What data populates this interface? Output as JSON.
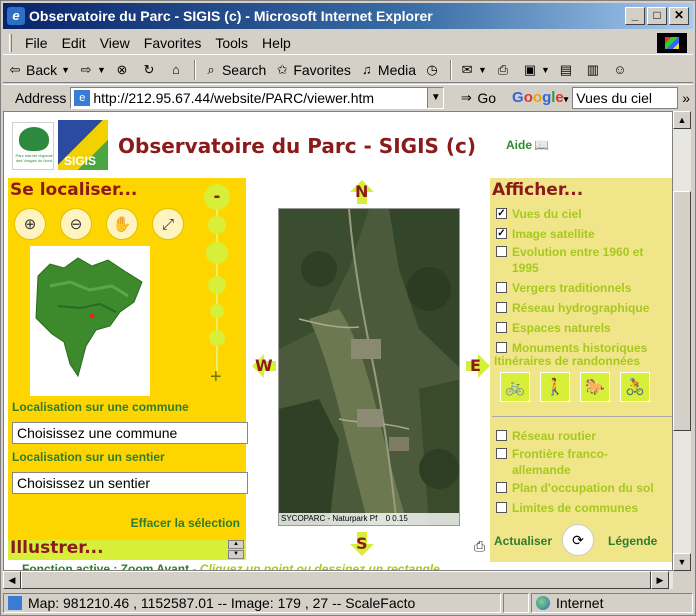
{
  "window": {
    "title": "Observatoire du Parc - SIGIS (c) - Microsoft Internet Explorer",
    "controls": {
      "minimize": "_",
      "maximize": "□",
      "close": "✕"
    }
  },
  "menu": [
    "File",
    "Edit",
    "View",
    "Favorites",
    "Tools",
    "Help"
  ],
  "toolbar": {
    "back": "Back",
    "search": "Search",
    "favorites": "Favorites",
    "media": "Media"
  },
  "address": {
    "label": "Address",
    "url": "http://212.95.67.44/website/PARC/viewer.htm",
    "go": "Go",
    "google_search_value": "Vues du ciel",
    "google_letters": [
      "G",
      "o",
      "o",
      "g",
      "l",
      "e"
    ]
  },
  "status": {
    "text": "Map: 981210.46 , 1152587.01 -- Image: 179 , 27 -- ScaleFacto",
    "zone": "Internet"
  },
  "page": {
    "title": "Observatoire du Parc - SIGIS (c)",
    "help": "Aide",
    "logo2_text": "SIGIS",
    "logo1_text": "Parc naturel régional des Vosges du Nord"
  },
  "left": {
    "title": "Se localiser...",
    "zoom_minus": "-",
    "zoom_plus": "+",
    "commune_label": "Localisation sur une commune",
    "commune_value": "Choisissez une commune",
    "sentier_label": "Localisation sur un sentier",
    "sentier_value": "Choisissez un sentier",
    "clear": "Effacer la sélection",
    "illustrer": "Illustrer..."
  },
  "compass": {
    "n": "N",
    "s": "S",
    "e": "E",
    "w": "W"
  },
  "map": {
    "copyright": "SYCOPARC - Naturpark Pf",
    "scale": "0      0.15"
  },
  "right": {
    "title": "Afficher...",
    "layers": [
      {
        "label": "Vues du ciel",
        "checked": true
      },
      {
        "label": "Image satellite",
        "checked": true
      },
      {
        "label": "Evolution entre 1960 et 1995",
        "checked": false
      },
      {
        "label": "Vergers traditionnels",
        "checked": false
      },
      {
        "label": "Réseau hydrographique",
        "checked": false
      },
      {
        "label": "Espaces naturels",
        "checked": false
      },
      {
        "label": "Monuments historiques",
        "checked": false
      }
    ],
    "rando_title": "Itinéraires de randonnées",
    "layers2": [
      {
        "label": "Réseau routier",
        "checked": false
      },
      {
        "label": "Frontière franco-allemande",
        "checked": false
      },
      {
        "label": "Plan d'occupation du sol",
        "checked": false
      },
      {
        "label": "Limites de communes",
        "checked": false
      }
    ],
    "refresh": "Actualiser",
    "legend": "Légende"
  },
  "footer": {
    "active": "Fonction active : Zoom Avant",
    "hint": " - Cliquez un point ou dessinez un rectangle"
  }
}
